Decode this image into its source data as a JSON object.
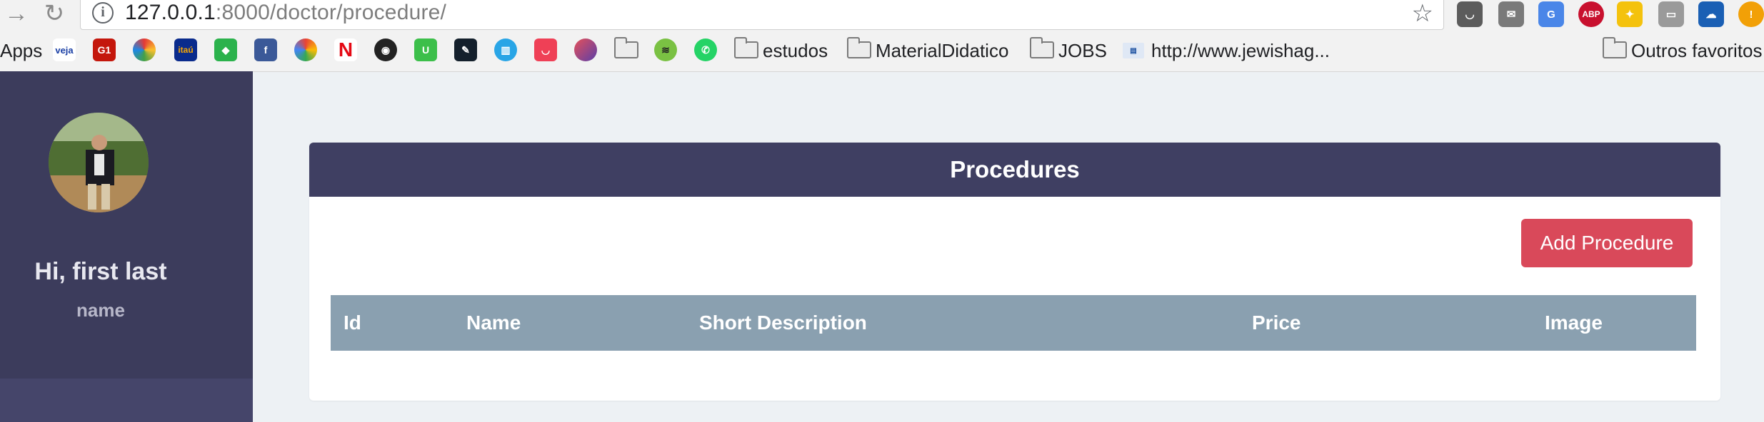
{
  "browser": {
    "url_host": "127.0.0.1",
    "url_rest": ":8000/doctor/procedure/",
    "bookmarks": {
      "apps": "Apps",
      "folders": [
        "estudos",
        "MaterialDidatico",
        "JOBS"
      ],
      "link": "http://www.jewishag...",
      "other": "Outros favoritos"
    },
    "favicons": [
      "veja",
      "G1",
      "klooks",
      "itau",
      "feedly",
      "facebook",
      "pinwheel",
      "netflix",
      "cbs",
      "U",
      "hackpad",
      "trello",
      "pocket",
      "gradient",
      "folder",
      "spotify",
      "whatsapp"
    ],
    "extensions": [
      "pocket",
      "mail",
      "google-translate",
      "adblock-plus",
      "star-extension",
      "cast",
      "cloud-extension",
      "warning"
    ]
  },
  "sidebar": {
    "greeting": "Hi, first last",
    "username": "name"
  },
  "card": {
    "title": "Procedures",
    "add_button": "Add Procedure",
    "columns": [
      "Id",
      "Name",
      "Short Description",
      "Price",
      "Image"
    ]
  },
  "colors": {
    "sidebar": "#3c3c5c",
    "header": "#3f3f62",
    "table_header": "#8aa0b0",
    "button": "#d9495a",
    "background": "#edf1f4"
  }
}
